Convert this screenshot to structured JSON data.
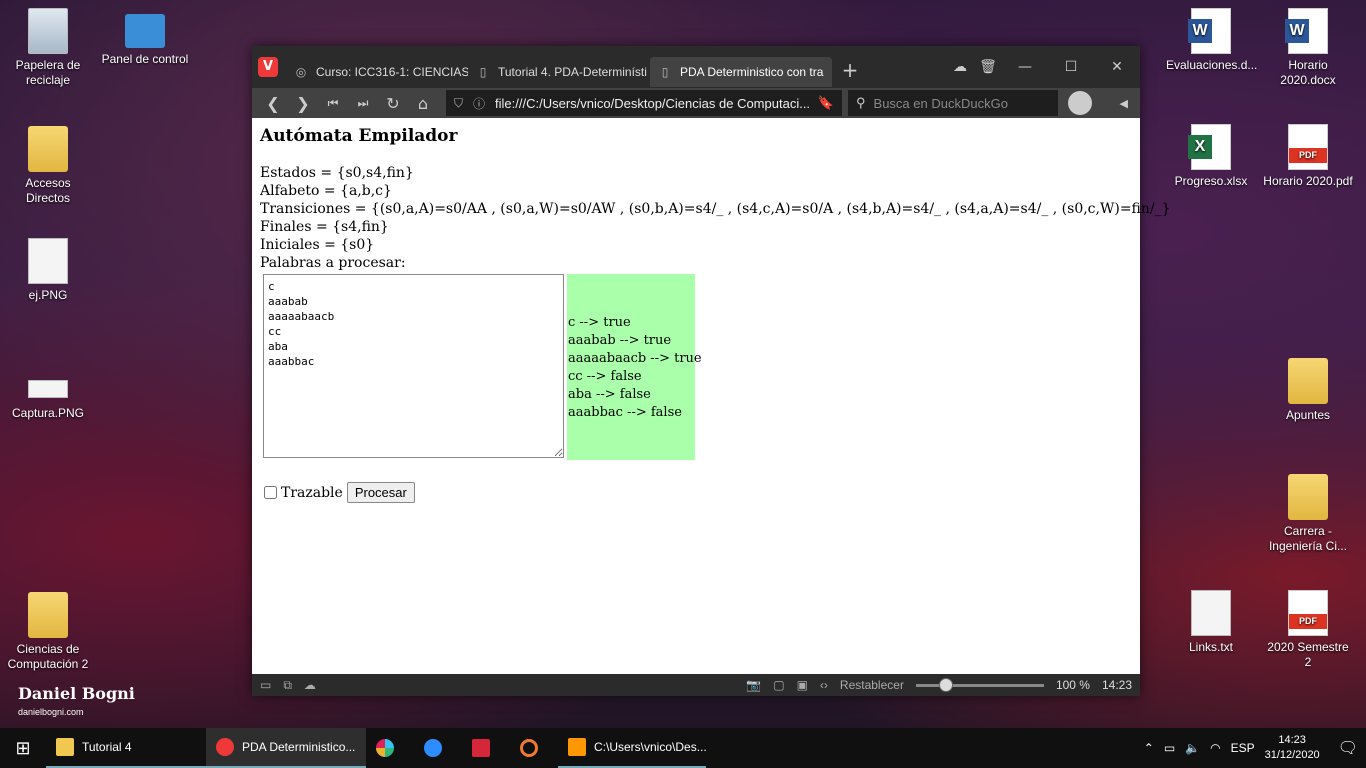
{
  "desktop": {
    "icons": [
      {
        "label": "Papelera de reciclaje"
      },
      {
        "label": "Panel de control"
      },
      {
        "label": "Accesos Directos"
      },
      {
        "label": "ej.PNG"
      },
      {
        "label": "Captura.PNG"
      },
      {
        "label": "Ciencias de Computación 2"
      },
      {
        "label": "Evaluaciones.d..."
      },
      {
        "label": "Horario 2020.docx"
      },
      {
        "label": "Progreso.xlsx"
      },
      {
        "label": "Horario 2020.pdf"
      },
      {
        "label": "Apuntes"
      },
      {
        "label": "Carrera - Ingeniería Ci..."
      },
      {
        "label": "Links.txt"
      },
      {
        "label": "2020 Semestre 2"
      }
    ],
    "watermark": {
      "name": "Daniel Bogni",
      "site": "danielbogni.com"
    }
  },
  "browser": {
    "tabs": [
      {
        "label": "Curso: ICC316-1: CIENCIAS"
      },
      {
        "label": "Tutorial 4. PDA-Determinísti"
      },
      {
        "label": "PDA Deterministico con tra"
      }
    ],
    "url": "file:///C:/Users/vnico/Desktop/Ciencias de Computaci...",
    "search_placeholder": "Busca en DuckDuckGo",
    "status": {
      "reset": "Restablecer",
      "zoom": "100 %",
      "zoom_level": 0.2,
      "time": "14:23"
    }
  },
  "page": {
    "title": "Autómata Empilador",
    "estados": "Estados = {s0,s4,fin}",
    "alfabeto": "Alfabeto = {a,b,c}",
    "transiciones": "Transiciones = {(s0,a,A)=s0/AA , (s0,a,W)=s0/AW , (s0,b,A)=s4/_ , (s4,c,A)=s0/A , (s4,b,A)=s4/_ , (s4,a,A)=s4/_ , (s0,c,W)=fin/_}",
    "finales": "Finales = {s4,fin}",
    "iniciales": "Iniciales = {s0}",
    "palabras_label": "Palabras a procesar:",
    "words_input": "c\naaabab\naaaaabaacb\ncc\naba\naaabbac",
    "results": [
      "c --> true",
      "aaabab --> true",
      "aaaaabaacb --> true",
      "cc --> false",
      "aba --> false",
      "aaabbac --> false"
    ],
    "trazable_label": "Trazable",
    "procesar_label": "Procesar"
  },
  "taskbar": {
    "items": [
      {
        "label": "Tutorial 4"
      },
      {
        "label": "PDA Deterministico..."
      },
      {
        "label": "C:\\Users\\vnico\\Des..."
      }
    ],
    "lang": "ESP",
    "time": "14:23",
    "date": "31/12/2020"
  }
}
